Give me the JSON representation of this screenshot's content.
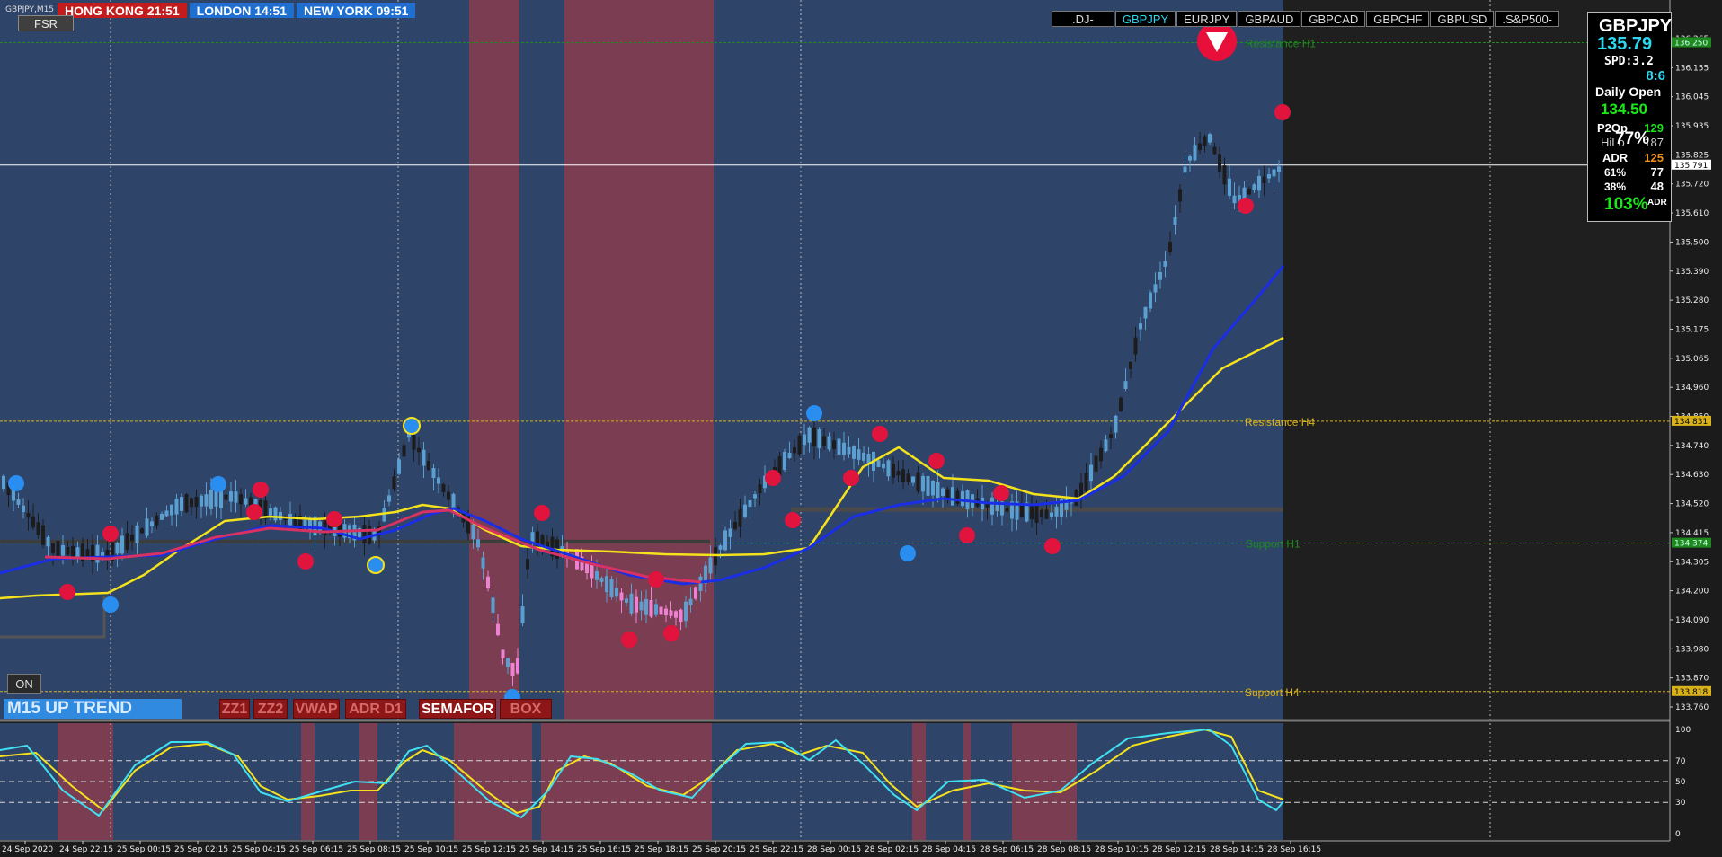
{
  "chart": {
    "symbol_label": "GBPJPY,M15",
    "fsr_label": "FSR",
    "on_label": "ON",
    "trend_label": "M15  UP TREND"
  },
  "clocks": [
    {
      "label": "HONG KONG 21:51",
      "color": "#c41c1c"
    },
    {
      "label": "LONDON  14:51",
      "color": "#1e6fd0"
    },
    {
      "label": "NEW YORK 09:51",
      "color": "#1e6fd0"
    }
  ],
  "pairs": [
    {
      "label": ".DJ-",
      "active": false
    },
    {
      "label": "GBPJPY",
      "active": true
    },
    {
      "label": "EURJPY",
      "active": false
    },
    {
      "label": "GBPAUD",
      "active": false
    },
    {
      "label": "GBPCAD",
      "active": false
    },
    {
      "label": "GBPCHF",
      "active": false
    },
    {
      "label": "GBPUSD",
      "active": false
    },
    {
      "label": ".S&P500-",
      "active": false
    }
  ],
  "indicators": [
    {
      "label": "ZZ1",
      "on": false
    },
    {
      "label": "ZZ2",
      "on": false
    },
    {
      "label": "VWAP",
      "on": false
    },
    {
      "label": "ADR D1",
      "on": false
    },
    {
      "label": "SEMAFOR",
      "on": true
    },
    {
      "label": "BOX",
      "on": false
    }
  ],
  "info_panel": {
    "symbol": "GBPJPY",
    "price": "135.79",
    "spread": "SPD:3.2",
    "countdown": "8:6",
    "daily_open_label": "Daily Open",
    "daily_open": "134.50",
    "p2o_label": "P2Op",
    "p2o_value": "129",
    "hilo_label": "HiLo",
    "hilo_value": "187",
    "overlay_pct": "77%",
    "adr_label": "ADR",
    "adr_value": "125",
    "r61_label": "61%",
    "r61_value": "77",
    "r38_label": "38%",
    "r38_value": "48",
    "adr_pct": "103%",
    "adr_pct_label": "ADR"
  },
  "levels": [
    {
      "label": "Resistance H1",
      "price": 136.25,
      "color": "#1e8a1e"
    },
    {
      "label": "Resistance H4",
      "price": 134.831,
      "color": "#d9b21a"
    },
    {
      "label": "Support H1",
      "price": 134.374,
      "color": "#1e8a1e"
    },
    {
      "label": "Support H4",
      "price": 133.818,
      "color": "#d9b21a"
    }
  ],
  "price_axis": [
    "136.265",
    "136.155",
    "136.045",
    "135.935",
    "135.825",
    "135.720",
    "135.610",
    "135.500",
    "135.390",
    "135.280",
    "135.175",
    "135.065",
    "134.960",
    "134.850",
    "134.740",
    "134.630",
    "134.520",
    "134.415",
    "134.305",
    "134.200",
    "134.090",
    "133.980",
    "133.870",
    "133.760"
  ],
  "price_tags": [
    {
      "text": "136.250",
      "price": 136.25,
      "bg": "#1e8a1e",
      "fg": "#cfe"
    },
    {
      "text": "135.791",
      "price": 135.791,
      "bg": "#ffffff",
      "fg": "#000"
    },
    {
      "text": "134.831",
      "price": 134.831,
      "bg": "#d9b21a",
      "fg": "#000"
    },
    {
      "text": "134.374",
      "price": 134.374,
      "bg": "#1e8a1e",
      "fg": "#cfe"
    },
    {
      "text": "133.818",
      "price": 133.818,
      "bg": "#d9b21a",
      "fg": "#000"
    }
  ],
  "osc_axis": [
    "100",
    "70",
    "50",
    "30",
    "0"
  ],
  "time_axis": [
    "24 Sep 2020",
    "24 Sep 22:15",
    "25 Sep 00:15",
    "25 Sep 02:15",
    "25 Sep 04:15",
    "25 Sep 06:15",
    "25 Sep 08:15",
    "25 Sep 10:15",
    "25 Sep 12:15",
    "25 Sep 14:15",
    "25 Sep 16:15",
    "25 Sep 18:15",
    "25 Sep 20:15",
    "25 Sep 22:15",
    "28 Sep 00:15",
    "28 Sep 02:15",
    "28 Sep 04:15",
    "28 Sep 06:15",
    "28 Sep 08:15",
    "28 Sep 10:15",
    "28 Sep 12:15",
    "28 Sep 14:15",
    "28 Sep 16:15"
  ],
  "colors": {
    "background": "#2f4469",
    "session_shade": "#7a3d52",
    "future_area": "#1f1f1f",
    "bull_candle": "#5a9fcf",
    "bear_candle": "#ee82d2",
    "ma_fast": "#1a2ee6",
    "ma_slow": "#f4e21c",
    "ma_mid": "#d83262",
    "semafor_high": "#e0143c",
    "semafor_low": "#2a8df0",
    "stoch_main": "#3fe0f0",
    "stoch_signal": "#f4e21c"
  }
}
